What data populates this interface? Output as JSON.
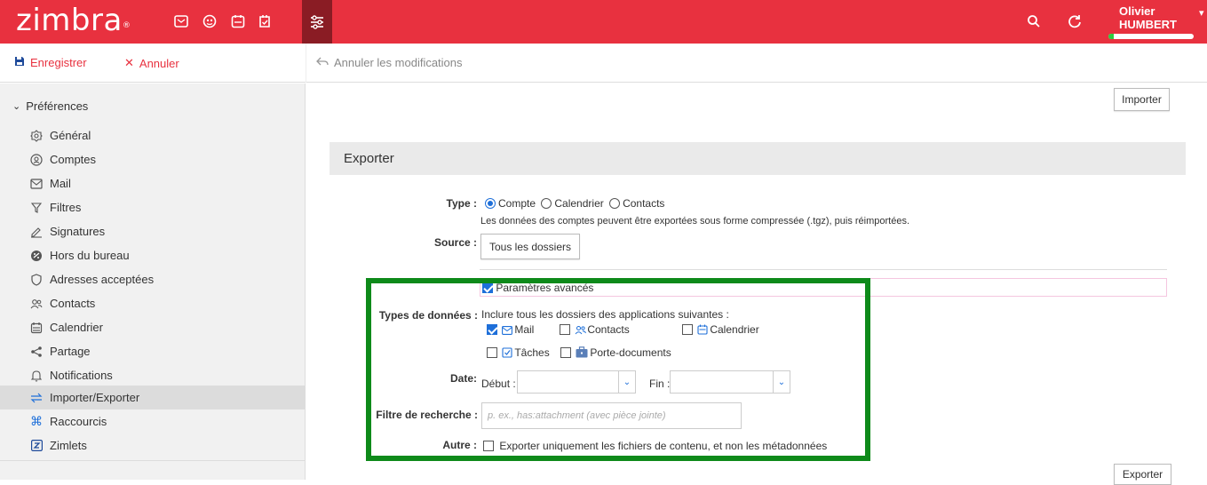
{
  "header": {
    "logo": "zimbra",
    "logo_mark": "®",
    "user_name": "Olivier HUMBERT",
    "quota_fraction": 0.06,
    "accent": "#e8313f",
    "apps": [
      "mail-icon",
      "contacts-icon",
      "calendar-icon",
      "tasks-icon",
      "preferences-icon"
    ]
  },
  "toolbar": {
    "save_label": "Enregistrer",
    "cancel_label": "Annuler",
    "undo_label": "Annuler les modifications"
  },
  "sidebar": {
    "title": "Préférences",
    "items": [
      {
        "label": "Général",
        "icon": "general-icon"
      },
      {
        "label": "Comptes",
        "icon": "accounts-icon"
      },
      {
        "label": "Mail",
        "icon": "mail-icon"
      },
      {
        "label": "Filtres",
        "icon": "filter-icon"
      },
      {
        "label": "Signatures",
        "icon": "signature-icon"
      },
      {
        "label": "Hors du bureau",
        "icon": "out-of-office-icon"
      },
      {
        "label": "Adresses acceptées",
        "icon": "shield-icon"
      },
      {
        "label": "Contacts",
        "icon": "contacts-icon"
      },
      {
        "label": "Calendrier",
        "icon": "calendar-icon"
      },
      {
        "label": "Partage",
        "icon": "share-icon"
      },
      {
        "label": "Notifications",
        "icon": "bell-icon"
      },
      {
        "label": "Importer/Exporter",
        "icon": "import-export-icon"
      },
      {
        "label": "Raccourcis",
        "icon": "shortcut-icon"
      },
      {
        "label": "Zimlets",
        "icon": "zimlet-icon"
      }
    ],
    "active_index": 11
  },
  "main": {
    "import_button": "Importer",
    "export_section_title": "Exporter",
    "type_label": "Type :",
    "type_options": [
      "Compte",
      "Calendrier",
      "Contacts"
    ],
    "type_selected": "Compte",
    "type_help": "Les données des comptes peuvent être exportées sous forme compressée (.tgz), puis réimportées.",
    "source_label": "Source :",
    "source_button": "Tous les dossiers",
    "advanced_label": "Paramètres avancés",
    "advanced_checked": true,
    "data_types_label": "Types de données :",
    "data_types_help": "Inclure tous les dossiers des applications suivantes :",
    "data_types": [
      {
        "label": "Mail",
        "checked": true
      },
      {
        "label": "Contacts",
        "checked": false
      },
      {
        "label": "Calendrier",
        "checked": false
      },
      {
        "label": "Tâches",
        "checked": false
      },
      {
        "label": "Porte-documents",
        "checked": false
      }
    ],
    "date_label": "Date:",
    "start_label": "Début :",
    "end_label": "Fin :",
    "search_label": "Filtre de recherche :",
    "search_placeholder": "p. ex., has:attachment (avec pièce jointe)",
    "other_label": "Autre :",
    "other_option": "Exporter uniquement les fichiers de contenu, et non les métadonnées",
    "export_button": "Exporter"
  }
}
